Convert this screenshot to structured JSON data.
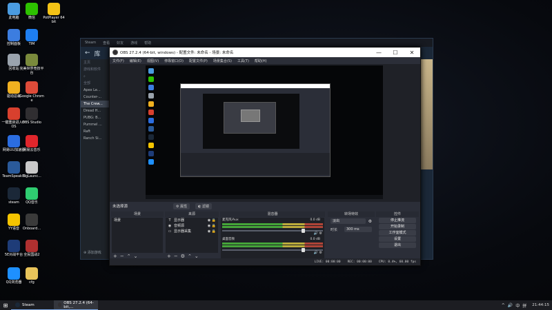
{
  "desktop": {
    "icons": [
      {
        "label": "此电脑",
        "icon": "computer-icon",
        "color": "#4a9be0"
      },
      {
        "label": "微信",
        "icon": "wechat-icon",
        "color": "#2dc100"
      },
      {
        "label": "PotPlayer 64 bit",
        "icon": "potplayer-icon",
        "color": "#f4c316"
      },
      {
        "label": "控制面板",
        "icon": "control-panel-icon",
        "color": "#3c7de0"
      },
      {
        "label": "TIM",
        "icon": "tim-icon",
        "color": "#1e7ef0"
      },
      {
        "label": "回收站",
        "icon": "recycle-bin-icon",
        "color": "#9aa3ad"
      },
      {
        "label": "完美世界竞技平台",
        "icon": "perfect-world-icon",
        "color": "#7a8a3c"
      },
      {
        "label": "驱动总裁",
        "icon": "driver-icon",
        "color": "#f0b020"
      },
      {
        "label": "Google Chrome",
        "icon": "chrome-icon",
        "color": "#dd4b39"
      },
      {
        "label": "一键重启进入BIOS",
        "icon": "bios-icon",
        "color": "#d8402e"
      },
      {
        "label": "OBS Studio",
        "icon": "obs-icon",
        "color": "#302e31"
      },
      {
        "label": "网易UU加速器",
        "icon": "uu-icon",
        "color": "#2b6de0"
      },
      {
        "label": "网易云音乐",
        "icon": "netease-music-icon",
        "color": "#e0262c"
      },
      {
        "label": "TeamSpeak 3",
        "icon": "teamspeak-icon",
        "color": "#2a5a9a"
      },
      {
        "label": "BigLaunc...",
        "icon": "biglauncher-icon",
        "color": "#c9c9c9"
      },
      {
        "label": "steam",
        "icon": "steam-icon",
        "color": "#1b2838"
      },
      {
        "label": "QQ音乐",
        "icon": "qq-music-icon",
        "color": "#2fcd71"
      },
      {
        "label": "YY语音",
        "icon": "yy-icon",
        "color": "#f5c400"
      },
      {
        "label": "Onboard...",
        "icon": "onboard-icon",
        "color": "#3a3a3a"
      },
      {
        "label": "5E对战平台",
        "icon": "5e-icon",
        "color": "#1e3c78"
      },
      {
        "label": "全民国战2",
        "icon": "game-icon",
        "color": "#b03030"
      },
      {
        "label": "QQ浏览器",
        "icon": "qq-browser-icon",
        "color": "#1e90ff"
      },
      {
        "label": "cfg",
        "icon": "folder-icon",
        "color": "#e8c45a"
      }
    ]
  },
  "steam": {
    "topbar": [
      "Steam",
      "查看",
      "好友",
      "游戏",
      "帮助"
    ],
    "nav_title": "库",
    "home": "主页",
    "collection": "游戏和软件",
    "section": "全部",
    "games": [
      "Apex Le...",
      "Counter-...",
      "The Crew...",
      "Dread H...",
      "PUBG: B...",
      "Pummel ...",
      "Raft",
      "Ranch Si..."
    ],
    "selected_index": 2,
    "add_game": "添加游戏"
  },
  "obs": {
    "title": "OBS 27.2.4 (64-bit, windows) - 配置文件: 未命名 - 场景: 未命名",
    "window_buttons": [
      "—",
      "☐",
      "✕"
    ],
    "menu": [
      "文件(F)",
      "编辑(E)",
      "视图(V)",
      "停靠窗口(D)",
      "配置文件(P)",
      "场景集合(S)",
      "工具(T)",
      "帮助(H)"
    ],
    "current_scene": "未选择源",
    "props_btn": "属性",
    "filters_btn": "滤镜",
    "docks": {
      "scenes": {
        "title": "场景",
        "items": [
          "场景"
        ]
      },
      "sources": {
        "title": "来源",
        "items": [
          {
            "icon": "T",
            "name": "显示器"
          },
          {
            "icon": "◉",
            "name": "音频源"
          },
          {
            "icon": "▭",
            "name": "显示器采集"
          }
        ]
      },
      "mixer": {
        "title": "混音器",
        "tracks": [
          {
            "name": "麦克风/Aux",
            "db": "0.0 dB"
          },
          {
            "name": "桌面音频",
            "db": "0.0 dB"
          }
        ]
      },
      "transitions": {
        "title": "转场特效",
        "type": "淡出",
        "duration_label": "时长",
        "duration": "300 ms"
      },
      "controls": {
        "title": "控件",
        "buttons": [
          "停止推流",
          "开始录制",
          "工作室模式",
          "设置",
          "退出"
        ]
      }
    },
    "status": {
      "live": "LIVE: 00:00:00",
      "rec": "REC: 00:00:00",
      "cpu": "CPU: 0.4%, 60.00 fps"
    }
  },
  "taskbar": {
    "start": "⊞",
    "apps": [
      {
        "label": "Steam",
        "color": "#1b2838"
      },
      {
        "label": "OBS 27.2.4 (64-bit,...",
        "color": "#302e31"
      }
    ],
    "tray": [
      "^",
      "🔊",
      "中",
      "拼"
    ],
    "time": "21:44:15"
  }
}
